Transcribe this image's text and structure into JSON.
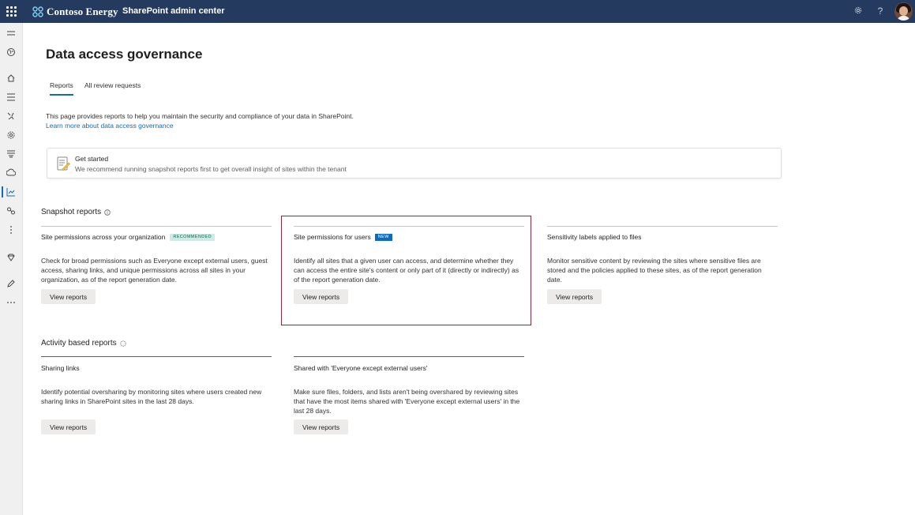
{
  "header": {
    "brand_name": "Contoso Energy",
    "app_name": "SharePoint admin center",
    "icons": [
      "waffle-icon",
      "settings-icon",
      "help-icon"
    ],
    "help_glyph": "?"
  },
  "page": {
    "title": "Data access governance",
    "tabs": [
      {
        "label": "Reports",
        "selected": true
      },
      {
        "label": "All review requests",
        "selected": false
      }
    ],
    "description": "This page provides reports to help you maintain the security and compliance of your data in SharePoint.",
    "learn_link": "Learn more about data access governance"
  },
  "get_started": {
    "title": "Get started",
    "text": "We recommend running snapshot reports first to get overall insight of sites within the tenant"
  },
  "snapshot": {
    "title": "Snapshot reports",
    "cards": [
      {
        "title": "Site permissions across your organization",
        "badge": "RECOMMENDED",
        "text": "Check for broad permissions such as Everyone except external users, guest access, sharing links, and unique permissions across all sites in your organization, as of the report generation date.",
        "button": "View reports"
      },
      {
        "title": "Site permissions for users",
        "badge": "NEW",
        "text": "Identify all sites that a given user can access, and determine whether they can access the entire site's content or only part of it (directly or indirectly) as of the report generation date.",
        "button": "View reports"
      },
      {
        "title": "Sensitivity labels applied to files",
        "text": "Monitor sensitive content by reviewing the sites where sensitive files are stored and the policies applied to these sites, as of the report generation date.",
        "button": "View reports"
      }
    ]
  },
  "activity": {
    "title": "Activity based reports",
    "cards": [
      {
        "title": "Sharing links",
        "text": "Identify potential oversharing by monitoring sites where users created new sharing links in SharePoint sites in the last 28 days.",
        "button": "View reports"
      },
      {
        "title": "Shared with 'Everyone except external users'",
        "text": "Make sure files, folders, and lists aren't being overshared by reviewing sites that have the most items shared with 'Everyone except external users' in the last 28 days.",
        "button": "View reports"
      }
    ]
  },
  "colors": {
    "topbar": "#243a5e",
    "accent": "#0f6cbd",
    "highlight_border": "#8a2a3e",
    "badge_recommended_bg": "#cfe9e4"
  }
}
